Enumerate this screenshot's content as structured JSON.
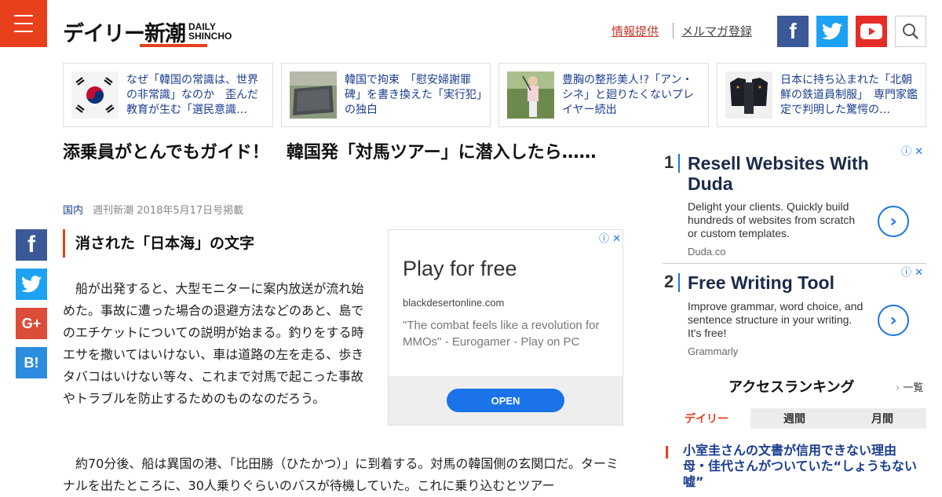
{
  "header": {
    "logo_jp": "デイリー新潮",
    "logo_en_1": "DAILY",
    "logo_en_2": "SHINCHO",
    "link_info": "情報提供",
    "link_mail": "メルマガ登録"
  },
  "top_cards": [
    {
      "text": "なぜ「韓国の常識は、世界の非常識」なのか　歪んだ教育が生む「選民意識…"
    },
    {
      "text": "韓国で拘束　「慰安婦謝罪碑」を書き換えた「実行犯」の独白"
    },
    {
      "text": "豊胸の整形美人!?「アン・シネ」と廻りたくないプレイヤー続出"
    },
    {
      "text": "日本に持ち込まれた「北朝鮮の鉄道員制服」　専門家鑑定で判明した驚愕の…"
    }
  ],
  "article": {
    "title": "添乗員がとんでもガイド！　韓国発「対馬ツアー」に潜入したら……",
    "category": "国内",
    "source": "週刊新潮 2018年5月17日号掲載",
    "subhead": "消された「日本海」の文字",
    "para1": "　船が出発すると、大型モニターに案内放送が流れ始めた。事故に遭った場合の退避方法などのあと、島でのエチケットについての説明が始まる。釣りをする時エサを撒いてはいけない、車は道路の左を走る、歩きタバコはいけない等々、これまで対馬で起こった事故やトラブルを防止するためのものなのだろう。",
    "para2": "　約70分後、船は異国の港、「比田勝（ひたかつ）」に到着する。対馬の韓国側の玄関口だ。ターミナルを出たところに、30人乗りぐらいのバスが待機していた。これに乗り込むとツアー"
  },
  "inline_ad": {
    "headline": "Play for free",
    "domain": "blackdesertonline.com",
    "description": "\"The combat feels like a revolution for MMOs\" - Eurogamer - Play on PC",
    "button": "OPEN"
  },
  "right_ads": [
    {
      "num": "1",
      "headline": "Resell Websites With Duda",
      "desc": "Delight your clients. Quickly build hundreds of websites from scratch or custom templates.",
      "source": "Duda.co"
    },
    {
      "num": "2",
      "headline": "Free Writing Tool",
      "desc": "Improve grammar, word choice, and sentence structure in your writing. It's free!",
      "source": "Grammarly"
    }
  ],
  "ranking": {
    "title": "アクセスランキング",
    "all_link": "一覧",
    "tabs": [
      "デイリー",
      "週間",
      "月間"
    ],
    "item1": "小室圭さんの文書が信用できない理由　母・佳代さんがついていた“しょうもない嘘”"
  },
  "colors": {
    "accent": "#e8401c",
    "link": "#1a3d8f",
    "facebook": "#3b5998",
    "twitter": "#1da1f2",
    "youtube": "#e52d27"
  }
}
